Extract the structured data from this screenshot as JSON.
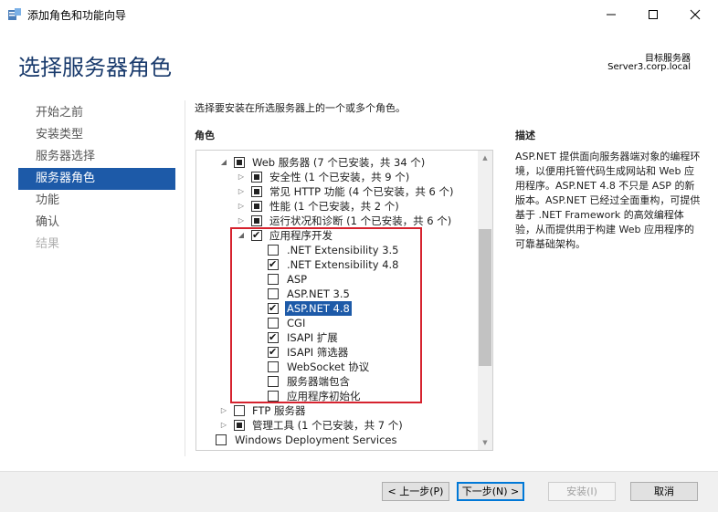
{
  "window": {
    "title": "添加角色和功能向导",
    "minimize_icon": "minimize-icon",
    "maximize_icon": "maximize-icon",
    "close_icon": "close-icon"
  },
  "header": {
    "page_title": "选择服务器角色",
    "target_label": "目标服务器",
    "target_server": "Server3.corp.local"
  },
  "nav": {
    "items": [
      {
        "label": "开始之前",
        "state": "normal"
      },
      {
        "label": "安装类型",
        "state": "normal"
      },
      {
        "label": "服务器选择",
        "state": "normal"
      },
      {
        "label": "服务器角色",
        "state": "active"
      },
      {
        "label": "功能",
        "state": "normal"
      },
      {
        "label": "确认",
        "state": "normal"
      },
      {
        "label": "结果",
        "state": "disabled"
      }
    ]
  },
  "main": {
    "instruction": "选择要安装在所选服务器上的一个或多个角色。",
    "roles_heading": "角色",
    "description_heading": "描述",
    "description_text": "ASP.NET 提供面向服务器端对象的编程环境，以便用托管代码生成网站和 Web 应用程序。ASP.NET 4.8 不只是 ASP 的新版本。ASP.NET 已经过全面重构，可提供基于 .NET Framework 的高效编程体验，从而提供用于构建 Web 应用程序的可靠基础架构。",
    "tree": [
      {
        "label": "Web 服务器 (7 个已安装，共 34 个)",
        "level": 1,
        "expander": "expanded",
        "state": "partial"
      },
      {
        "label": "安全性 (1 个已安装，共 9 个)",
        "level": 2,
        "expander": "collapsed",
        "state": "partial"
      },
      {
        "label": "常见 HTTP 功能 (4 个已安装，共 6 个)",
        "level": 2,
        "expander": "collapsed",
        "state": "partial"
      },
      {
        "label": "性能 (1 个已安装，共 2 个)",
        "level": 2,
        "expander": "collapsed",
        "state": "partial"
      },
      {
        "label": "运行状况和诊断 (1 个已安装，共 6 个)",
        "level": 2,
        "expander": "collapsed",
        "state": "partial"
      },
      {
        "label": "应用程序开发",
        "level": 2,
        "expander": "expanded",
        "state": "checked"
      },
      {
        "label": ".NET Extensibility 3.5",
        "level": 3,
        "expander": "none",
        "state": "unchecked"
      },
      {
        "label": ".NET Extensibility 4.8",
        "level": 3,
        "expander": "none",
        "state": "checked"
      },
      {
        "label": "ASP",
        "level": 3,
        "expander": "none",
        "state": "unchecked"
      },
      {
        "label": "ASP.NET 3.5",
        "level": 3,
        "expander": "none",
        "state": "unchecked"
      },
      {
        "label": "ASP.NET 4.8",
        "level": 3,
        "expander": "none",
        "state": "checked",
        "selected": true
      },
      {
        "label": "CGI",
        "level": 3,
        "expander": "none",
        "state": "unchecked"
      },
      {
        "label": "ISAPI 扩展",
        "level": 3,
        "expander": "none",
        "state": "checked"
      },
      {
        "label": "ISAPI 筛选器",
        "level": 3,
        "expander": "none",
        "state": "checked"
      },
      {
        "label": "WebSocket 协议",
        "level": 3,
        "expander": "none",
        "state": "unchecked"
      },
      {
        "label": "服务器端包含",
        "level": 3,
        "expander": "none",
        "state": "unchecked"
      },
      {
        "label": "应用程序初始化",
        "level": 3,
        "expander": "none",
        "state": "unchecked"
      },
      {
        "label": "FTP 服务器",
        "level": 1,
        "expander": "collapsed",
        "state": "unchecked"
      },
      {
        "label": "管理工具 (1 个已安装，共 7 个)",
        "level": 1,
        "expander": "collapsed",
        "state": "partial"
      },
      {
        "label": "Windows Deployment Services",
        "level": 0,
        "expander": "none",
        "state": "unchecked"
      }
    ]
  },
  "footer": {
    "prev_label": "< 上一步(P)",
    "next_label": "下一步(N) >",
    "install_label": "安装(I)",
    "cancel_label": "取消"
  },
  "colors": {
    "accent": "#1d5aa8",
    "highlight_box": "#d6232f",
    "title_text": "#1a3b6d"
  }
}
